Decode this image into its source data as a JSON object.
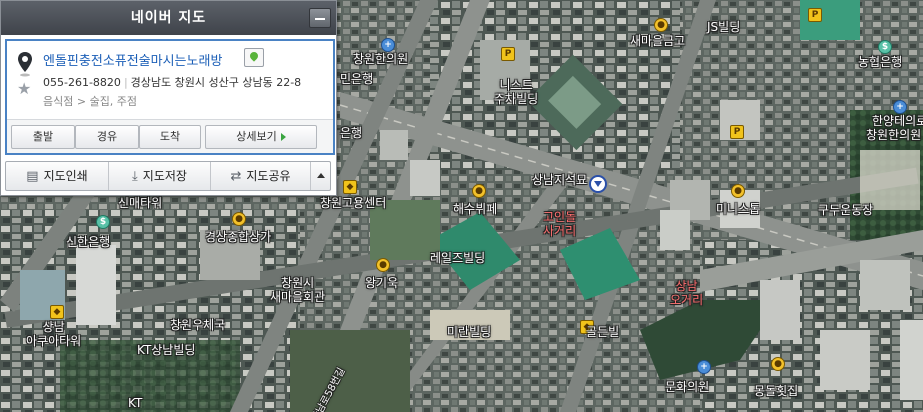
{
  "panel": {
    "title": "네이버 지도",
    "place": {
      "name": "엔돌핀충전소퓨전술마시는노래방",
      "phone": "055-261-8820",
      "address": "경상남도 창원시 성산구 상남동 22-8",
      "category": "음식점 > 술집, 주점"
    },
    "actions": {
      "start": "출발",
      "via": "경유",
      "arrive": "도착",
      "detail": "상세보기"
    },
    "tools": {
      "print": "지도인쇄",
      "save": "지도저장",
      "share": "지도공유"
    }
  },
  "map_labels": {
    "changwon_hanuiwon": "창원한의원",
    "bank_top": "민은행",
    "bank_mid": "은행",
    "parking": "니스트\n주차빌딩",
    "saemaeul_geumgo": "새마을금고",
    "js_building": "JS빌딩",
    "nonghyup": "농협은행",
    "hanyang": "한양테의로",
    "changwon_hanuiwon_right": "창원한의원",
    "sangnam_jiseokmyo": "상남지석묘",
    "goindol_sageori": "고인돌\n사거리",
    "jjampong": "해수뷔페",
    "minisu": "미니스톱",
    "gudu_undongjang": "구두운동장",
    "sinmaewi": "신매타워",
    "sinhan_bank": "신한은행",
    "changwon_employment": "창원고용센터",
    "gyeongsang_bank": "경상종합상가",
    "lake_building": "레일즈빌딩",
    "wangguk": "왕기욱",
    "saemaeul_hoegwan": "창원시\n새마을회관",
    "miran_building": "미란빌딩",
    "golden_bill": "골든빌",
    "sangnam_ogeori": "상남\n오거리",
    "sangnam_aquatower": "상남\n아쿠아타워",
    "changwon_post": "창원우체국",
    "kt_building": "KT상남빌딩",
    "munhwa_uiwon": "문화의원",
    "mongdol_hoetjip": "몽돌횟집",
    "kt_bottom": "KT",
    "road_label": "상남로58번길"
  },
  "colors": {
    "title_bar": "#4a4e55",
    "link_blue": "#1c5fb7",
    "panel_border": "#4a82c4",
    "label_red": "#ff6f6f"
  }
}
